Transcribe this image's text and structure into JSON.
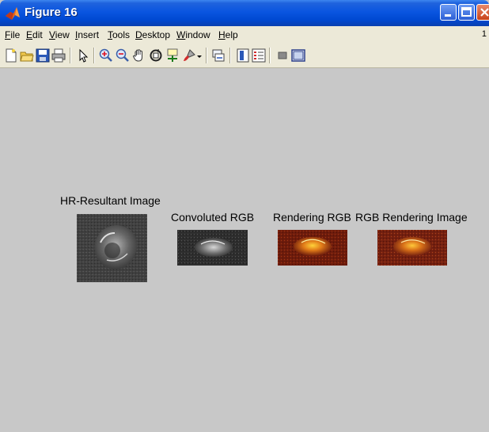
{
  "window": {
    "title": "Figure 16",
    "menu": [
      {
        "key": "F",
        "rest": "ile"
      },
      {
        "key": "E",
        "rest": "dit"
      },
      {
        "key": "V",
        "rest": "iew"
      },
      {
        "key": "I",
        "rest": "nsert"
      },
      {
        "key": "T",
        "rest": "ools"
      },
      {
        "key": "D",
        "rest": "esktop"
      },
      {
        "key": "W",
        "rest": "indow"
      },
      {
        "key": "H",
        "rest": "elp"
      }
    ],
    "menu_corner": "1"
  },
  "toolbar": {
    "icons": [
      "new-figure-icon",
      "open-file-icon",
      "save-icon",
      "print-icon",
      "pointer-icon",
      "zoom-in-icon",
      "zoom-out-icon",
      "pan-hand-icon",
      "rotate-3d-icon",
      "data-cursor-icon",
      "brush-icon",
      "link-plot-icon",
      "colorbar-icon",
      "legend-icon",
      "hide-plot-tools-icon",
      "show-plot-tools-icon"
    ]
  },
  "figure": {
    "panels": [
      {
        "title": "HR-Resultant Image"
      },
      {
        "title": "Convoluted RGB"
      },
      {
        "title": "Rendering RGB"
      },
      {
        "title": "RGB Rendering Image"
      }
    ]
  },
  "colors": {
    "titlebar": "#0a55e0",
    "figure_bg": "#c8c8c8",
    "menubar_bg": "#ece9d8"
  }
}
